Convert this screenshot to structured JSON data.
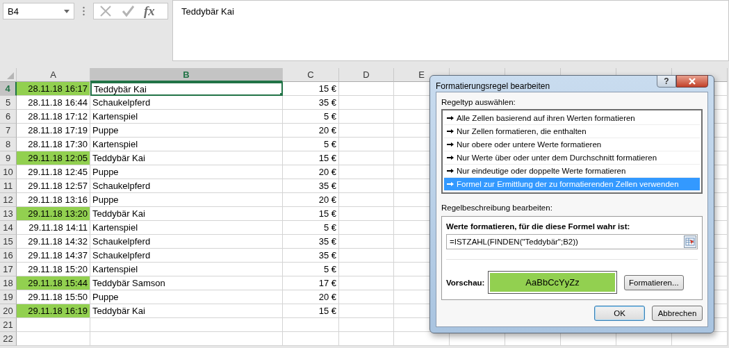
{
  "name_box": {
    "value": "B4"
  },
  "formula_bar": {
    "function_label": "fx",
    "value": "Teddybär Kai"
  },
  "columns": [
    {
      "label": "A",
      "selected": false
    },
    {
      "label": "B",
      "selected": true
    },
    {
      "label": "C",
      "selected": false
    },
    {
      "label": "D",
      "selected": false
    },
    {
      "label": "E",
      "selected": false
    }
  ],
  "rows": [
    {
      "number": "4",
      "selected": true,
      "a": "28.11.18 16:17",
      "highlighted": true,
      "b": "Teddybär Kai",
      "b_selected": true,
      "c": "15 €"
    },
    {
      "number": "5",
      "selected": false,
      "a": "28.11.18 16:44",
      "highlighted": false,
      "b": "Schaukelpferd",
      "b_selected": false,
      "c": "35 €"
    },
    {
      "number": "6",
      "selected": false,
      "a": "28.11.18 17:12",
      "highlighted": false,
      "b": "Kartenspiel",
      "b_selected": false,
      "c": "5 €"
    },
    {
      "number": "7",
      "selected": false,
      "a": "28.11.18 17:19",
      "highlighted": false,
      "b": "Puppe",
      "b_selected": false,
      "c": "20 €"
    },
    {
      "number": "8",
      "selected": false,
      "a": "28.11.18 17:30",
      "highlighted": false,
      "b": "Kartenspiel",
      "b_selected": false,
      "c": "5 €"
    },
    {
      "number": "9",
      "selected": false,
      "a": "29.11.18 12:05",
      "highlighted": true,
      "b": "Teddybär Kai",
      "b_selected": false,
      "c": "15 €"
    },
    {
      "number": "10",
      "selected": false,
      "a": "29.11.18 12:45",
      "highlighted": false,
      "b": "Puppe",
      "b_selected": false,
      "c": "20 €"
    },
    {
      "number": "11",
      "selected": false,
      "a": "29.11.18 12:57",
      "highlighted": false,
      "b": "Schaukelpferd",
      "b_selected": false,
      "c": "35 €"
    },
    {
      "number": "12",
      "selected": false,
      "a": "29.11.18 13:16",
      "highlighted": false,
      "b": "Puppe",
      "b_selected": false,
      "c": "20 €"
    },
    {
      "number": "13",
      "selected": false,
      "a": "29.11.18 13:20",
      "highlighted": true,
      "b": "Teddybär Kai",
      "b_selected": false,
      "c": "15 €"
    },
    {
      "number": "14",
      "selected": false,
      "a": "29.11.18 14:11",
      "highlighted": false,
      "b": "Kartenspiel",
      "b_selected": false,
      "c": "5 €"
    },
    {
      "number": "15",
      "selected": false,
      "a": "29.11.18 14:32",
      "highlighted": false,
      "b": "Schaukelpferd",
      "b_selected": false,
      "c": "35 €"
    },
    {
      "number": "16",
      "selected": false,
      "a": "29.11.18 14:37",
      "highlighted": false,
      "b": "Schaukelpferd",
      "b_selected": false,
      "c": "35 €"
    },
    {
      "number": "17",
      "selected": false,
      "a": "29.11.18 15:20",
      "highlighted": false,
      "b": "Kartenspiel",
      "b_selected": false,
      "c": "5 €"
    },
    {
      "number": "18",
      "selected": false,
      "a": "29.11.18 15:44",
      "highlighted": true,
      "b": "Teddybär Samson",
      "b_selected": false,
      "c": "17 €"
    },
    {
      "number": "19",
      "selected": false,
      "a": "29.11.18 15:50",
      "highlighted": false,
      "b": "Puppe",
      "b_selected": false,
      "c": "20 €"
    },
    {
      "number": "20",
      "selected": false,
      "a": "29.11.18 16:19",
      "highlighted": true,
      "b": "Teddybär Kai",
      "b_selected": false,
      "c": "15 €"
    },
    {
      "number": "21",
      "selected": false
    },
    {
      "number": "22",
      "selected": false
    }
  ],
  "dialog": {
    "title": "Formatierungsregel bearbeiten",
    "help": "?",
    "rule_type_label": "Regeltyp auswählen:",
    "rule_types": [
      {
        "label": "Alle Zellen basierend auf ihren Werten formatieren",
        "selected": false
      },
      {
        "label": "Nur Zellen formatieren, die enthalten",
        "selected": false
      },
      {
        "label": "Nur obere oder untere Werte formatieren",
        "selected": false
      },
      {
        "label": "Nur Werte über oder unter dem Durchschnitt formatieren",
        "selected": false
      },
      {
        "label": "Nur eindeutige oder doppelte Werte formatieren",
        "selected": false
      },
      {
        "label": "Formel zur Ermittlung der zu formatierenden Zellen verwenden",
        "selected": true
      }
    ],
    "description_label": "Regelbeschreibung bearbeiten:",
    "formula_label": "Werte formatieren, für die diese Formel wahr ist:",
    "formula": "=ISTZAHL(FINDEN(\"Teddybär\";B2))",
    "preview_label": "Vorschau:",
    "preview_text": "AaBbCcYyZz",
    "format_button": "Formatieren...",
    "ok_button": "OK",
    "cancel_button": "Abbrechen"
  }
}
